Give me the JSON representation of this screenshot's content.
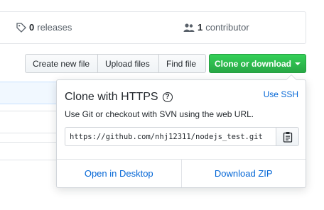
{
  "stats": {
    "releases_count": "0",
    "releases_label": "releases",
    "contributors_count": "1",
    "contributors_label": "contributor"
  },
  "toolbar": {
    "create_label": "Create new file",
    "upload_label": "Upload files",
    "find_label": "Find file",
    "clone_label": "Clone or download"
  },
  "clone": {
    "title": "Clone with HTTPS",
    "use_ssh": "Use SSH",
    "description": "Use Git or checkout with SVN using the web URL.",
    "url": "https://github.com/nhj12311/nodejs_test.git",
    "open_desktop": "Open in Desktop",
    "download_zip": "Download ZIP"
  },
  "colors": {
    "accent_link": "#0366d6",
    "clone_button": "#28a745"
  },
  "icons": {
    "releases": "tag-icon",
    "contributors": "people-icon",
    "help": "help-icon",
    "copy": "clipboard-icon",
    "caret": "caret-down-icon"
  }
}
